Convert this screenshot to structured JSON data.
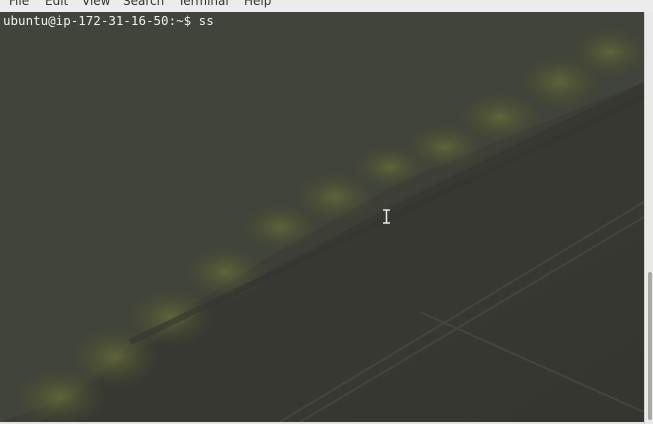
{
  "menu": [
    "File",
    "Edit",
    "View",
    "Search",
    "Terminal",
    "Help"
  ],
  "terminal": {
    "prompt": "ubuntu@ip-172-31-16-50:~$ ",
    "command": "ss"
  },
  "colors": {
    "terminal_bg": "#3b3c36",
    "foliage": "#5d6437",
    "text": "#f0f0ec"
  },
  "icons": {
    "cursor": "text-cursor-ibeam-icon"
  }
}
